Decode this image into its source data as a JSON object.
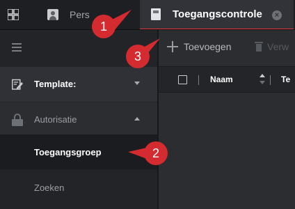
{
  "app": {
    "tabs": [
      {
        "label": "Pers",
        "active": false,
        "icon": "person-icon"
      },
      {
        "label": "Toegangscontrole",
        "active": true,
        "icon": "document-icon"
      }
    ],
    "accent_color": "#e4393c"
  },
  "toolbar": {
    "add_label": "Toevoegen",
    "delete_label": "Verw"
  },
  "sidebar": {
    "items": [
      {
        "label": "Template:",
        "icon": "edit-icon",
        "expanded": false
      },
      {
        "label": "Autorisatie",
        "icon": "lock-icon",
        "expanded": true
      },
      {
        "label": "Toegangsgroep",
        "selected": true
      },
      {
        "label": "Zoeken"
      }
    ]
  },
  "table": {
    "columns": [
      "Naam",
      "Te"
    ]
  },
  "callouts": [
    {
      "number": "1"
    },
    {
      "number": "2"
    },
    {
      "number": "3"
    }
  ]
}
